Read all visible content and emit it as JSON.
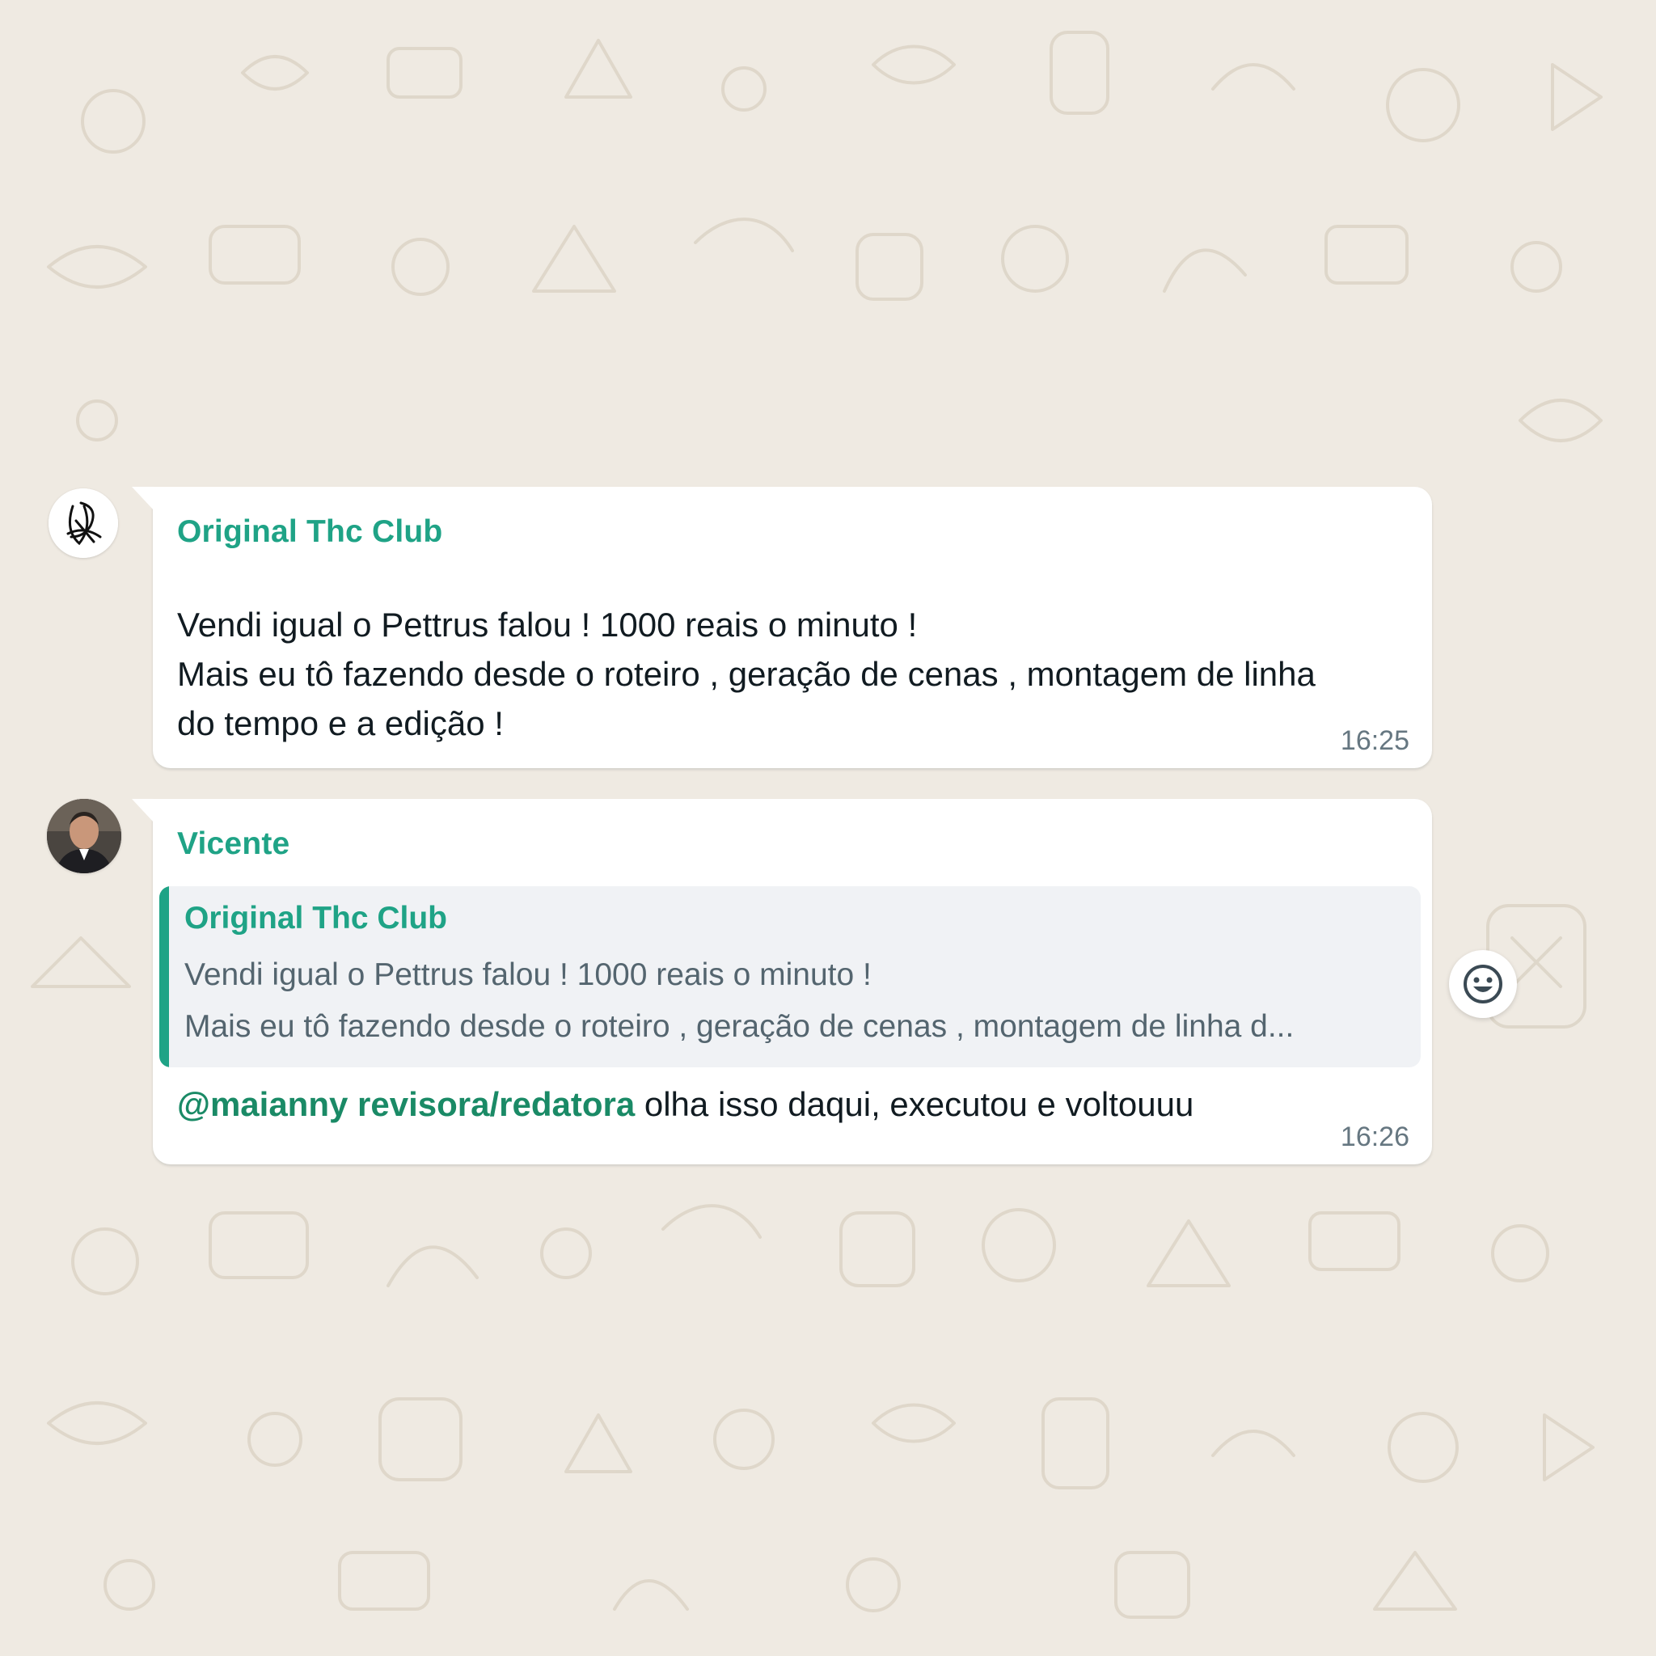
{
  "messages": [
    {
      "sender": "Original Thc Club",
      "lines": [
        "Vendi igual o Pettrus falou ! 1000 reais o minuto !",
        "Mais eu tô fazendo desde o roteiro , geração de cenas , montagem de linha",
        "do tempo e a edição !"
      ],
      "time": "16:25",
      "avatar_icon": "signature-logo-icon"
    },
    {
      "sender": "Vicente",
      "quote": {
        "sender": "Original Thc Club",
        "line1": "Vendi igual o Pettrus falou ! 1000 reais o minuto !",
        "line2": "Mais eu tô fazendo desde o roteiro , geração de cenas , montagem de linha d..."
      },
      "mention": "@maianny revisora/redatora",
      "text": " olha isso daqui, executou e voltouuu",
      "time": "16:26",
      "avatar_icon": "person-photo-icon"
    }
  ],
  "reaction_button_icon": "smiley-icon",
  "colors": {
    "background": "#efeae2",
    "bubble": "#ffffff",
    "sender_name": "#1fa386",
    "mention": "#1a8a66",
    "quote_bg": "#f0f2f5",
    "text": "#111b21",
    "timestamp": "#667781"
  }
}
